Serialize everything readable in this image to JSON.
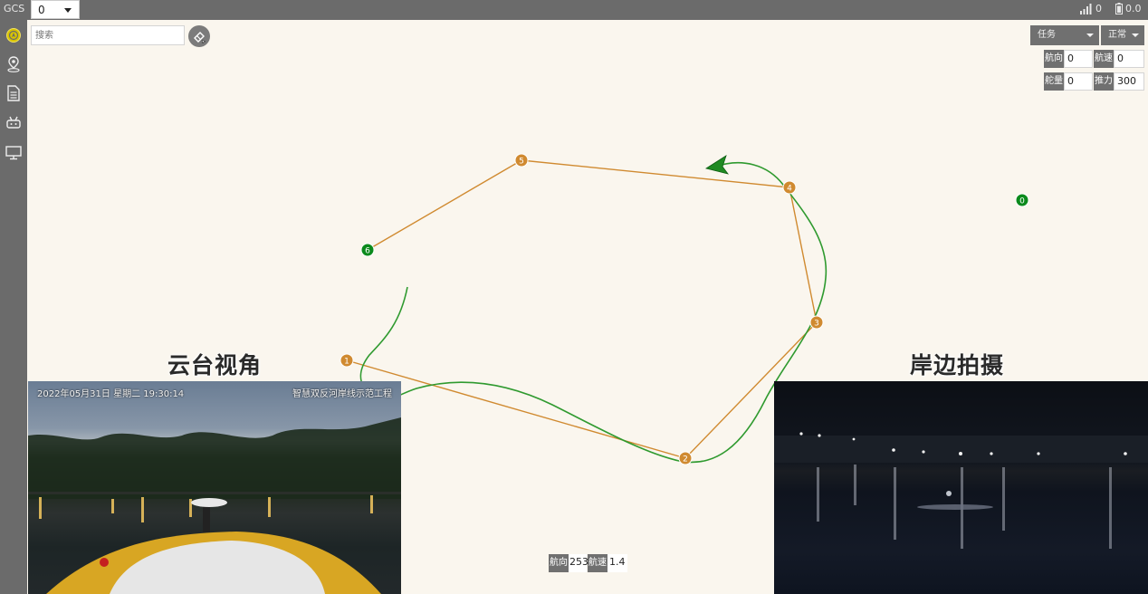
{
  "topbar": {
    "app_title": "GCS",
    "vehicle_select": "0",
    "signal_value": "0",
    "battery_value": "0.0"
  },
  "sidebar": {
    "items": [
      "vehicle-icon",
      "location-pin-icon",
      "document-icon",
      "robot-icon",
      "monitor-icon"
    ]
  },
  "search": {
    "placeholder": "搜索"
  },
  "controls": {
    "mode_dropdown": "任务",
    "status_dropdown": "正常"
  },
  "telemetry": {
    "heading_label": "航向",
    "heading_value": "0",
    "speed_label": "航速",
    "speed_value": "0",
    "rudder_label": "舵量",
    "rudder_value": "0",
    "thrust_label": "推力",
    "thrust_value": "300"
  },
  "bottom_telemetry": {
    "heading_label": "航向",
    "heading_value": "253",
    "speed_label": "航速",
    "speed_value": "1.4"
  },
  "map": {
    "waypoints": [
      "1",
      "2",
      "3",
      "4",
      "5",
      "6"
    ],
    "home_marker": "0"
  },
  "overlays": {
    "gimbal_title": "云台视角",
    "shore_title": "岸边拍摄",
    "gimbal_timestamp": "2022年05月31日  星期二  19:30:14",
    "gimbal_caption": "智慧双反河岸线示范工程"
  },
  "colors": {
    "route": "#d08a30",
    "track": "#2f9a2f",
    "waypoint_fill": "#d08a30",
    "marker_green": "#0b8a1c",
    "panel_gray": "#707070"
  }
}
